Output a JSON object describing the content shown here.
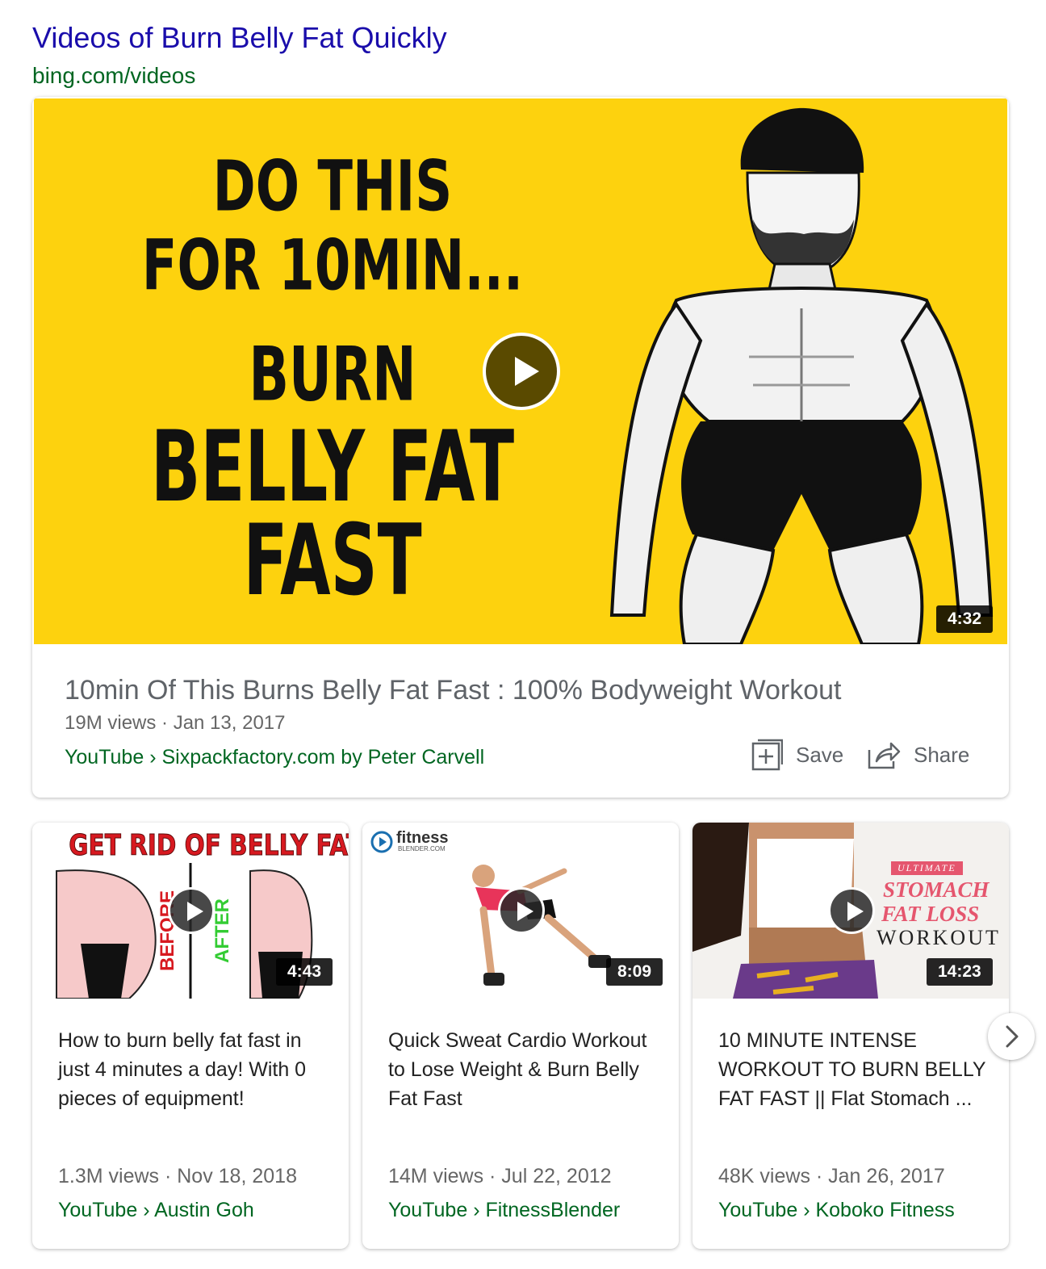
{
  "header": {
    "title": "Videos of Burn Belly Fat Quickly",
    "url": "bing.com/videos"
  },
  "featured": {
    "thumbnail_text": {
      "line1": "DO THIS",
      "line2": "FOR 10MIN...",
      "line3": "BURN",
      "line4": "BELLY FAT",
      "line5": "FAST"
    },
    "duration": "4:32",
    "title": "10min Of This Burns Belly Fat Fast : 100% Bodyweight Workout",
    "meta": "19M views · Jan 13, 2017",
    "source": "YouTube › Sixpackfactory.com by Peter Carvell",
    "save_label": "Save",
    "share_label": "Share"
  },
  "cards": [
    {
      "thumb_heading": "GET RID OF BELLY FAT",
      "thumb_before": "BEFORE",
      "thumb_after": "AFTER",
      "duration": "4:43",
      "title": "How to burn belly fat fast in just 4 minutes a day! With 0 pieces of equipment!",
      "meta": "1.3M views · Nov 18, 2018",
      "source": "YouTube › Austin Goh"
    },
    {
      "thumb_logo": "fitness",
      "thumb_logo_sub": "BLENDER.COM",
      "duration": "8:09",
      "title": "Quick Sweat Cardio Workout to Lose Weight & Burn Belly Fat Fast",
      "meta": "14M views · Jul 22, 2012",
      "source": "YouTube › FitnessBlender"
    },
    {
      "thumb_tag": "ULTIMATE",
      "thumb_line1": "STOMACH",
      "thumb_line2": "FAT LOSS",
      "thumb_line3": "WORKOUT",
      "duration": "14:23",
      "title": "10 MINUTE INTENSE WORKOUT TO BURN BELLY FAT FAST || Flat Stomach ...",
      "meta": "48K views · Jan 26, 2017",
      "source": "YouTube › Koboko Fitness"
    }
  ],
  "colors": {
    "link": "#1a0dab",
    "url_green": "#006621",
    "thumb_yellow": "#fdd20e"
  }
}
